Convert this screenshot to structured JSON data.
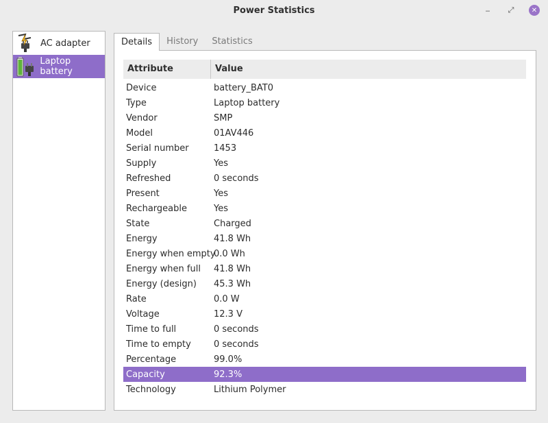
{
  "window": {
    "title": "Power Statistics",
    "minimize_glyph": "‒",
    "restore_glyph": "⤢",
    "close_glyph": "✕"
  },
  "devices": [
    {
      "label": "AC adapter",
      "icon": "ac-adapter-icon",
      "selected": false
    },
    {
      "label": "Laptop battery",
      "icon": "battery-icon",
      "selected": true
    }
  ],
  "tabs": [
    {
      "label": "Details",
      "active": true
    },
    {
      "label": "History",
      "active": false
    },
    {
      "label": "Statistics",
      "active": false
    }
  ],
  "table": {
    "headers": {
      "attribute": "Attribute",
      "value": "Value"
    },
    "rows": [
      {
        "attribute": "Device",
        "value": "battery_BAT0"
      },
      {
        "attribute": "Type",
        "value": "Laptop battery"
      },
      {
        "attribute": "Vendor",
        "value": "SMP"
      },
      {
        "attribute": "Model",
        "value": "01AV446"
      },
      {
        "attribute": "Serial number",
        "value": "1453"
      },
      {
        "attribute": "Supply",
        "value": "Yes"
      },
      {
        "attribute": "Refreshed",
        "value": "0 seconds"
      },
      {
        "attribute": "Present",
        "value": "Yes"
      },
      {
        "attribute": "Rechargeable",
        "value": "Yes"
      },
      {
        "attribute": "State",
        "value": "Charged"
      },
      {
        "attribute": "Energy",
        "value": "41.8 Wh"
      },
      {
        "attribute": "Energy when empty",
        "value": "0.0 Wh"
      },
      {
        "attribute": "Energy when full",
        "value": "41.8 Wh"
      },
      {
        "attribute": "Energy (design)",
        "value": "45.3 Wh"
      },
      {
        "attribute": "Rate",
        "value": "0.0 W"
      },
      {
        "attribute": "Voltage",
        "value": "12.3 V"
      },
      {
        "attribute": "Time to full",
        "value": "0 seconds"
      },
      {
        "attribute": "Time to empty",
        "value": "0 seconds"
      },
      {
        "attribute": "Percentage",
        "value": "99.0%"
      },
      {
        "attribute": "Capacity",
        "value": "92.3%",
        "selected": true
      },
      {
        "attribute": "Technology",
        "value": "Lithium Polymer"
      }
    ]
  },
  "colors": {
    "accent": "#8e6dc9",
    "close_button": "#9a74c8",
    "window_bg": "#ececec"
  }
}
